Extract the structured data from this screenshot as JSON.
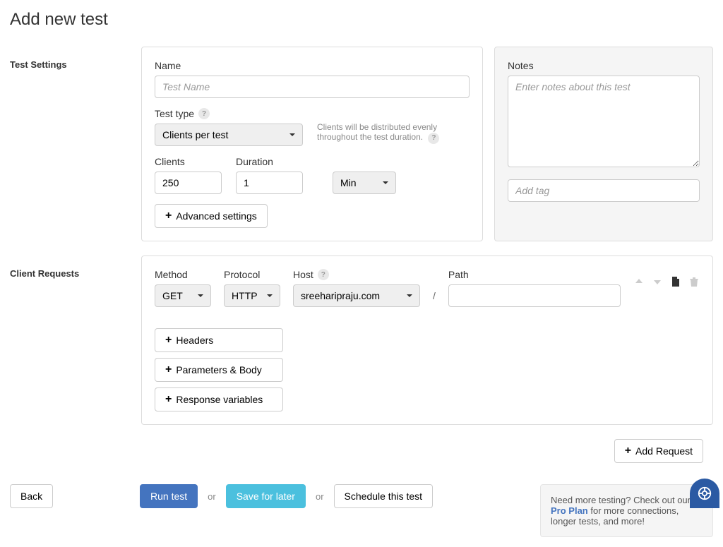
{
  "pageTitle": "Add new test",
  "sections": {
    "testSettings": "Test Settings",
    "clientRequests": "Client Requests"
  },
  "testSettings": {
    "nameLabel": "Name",
    "namePlaceholder": "Test Name",
    "nameValue": "",
    "testTypeLabel": "Test type",
    "testTypeValue": "Clients per test",
    "testTypeHelp": "Clients will be distributed evenly throughout the test duration.",
    "clientsLabel": "Clients",
    "clientsValue": "250",
    "durationLabel": "Duration",
    "durationValue": "1",
    "durationUnitValue": "Min",
    "advancedSettings": "Advanced settings"
  },
  "notes": {
    "notesLabel": "Notes",
    "notesPlaceholder": "Enter notes about this test",
    "notesValue": "",
    "addTagPlaceholder": "Add tag",
    "addTagValue": ""
  },
  "requests": {
    "methodLabel": "Method",
    "methodValue": "GET",
    "protocolLabel": "Protocol",
    "protocolValue": "HTTP",
    "hostLabel": "Host",
    "hostValue": "sreeharipraju.com",
    "pathLabel": "Path",
    "pathValue": "",
    "pathSeparator": "/",
    "headers": "Headers",
    "parametersBody": "Parameters & Body",
    "responseVariables": "Response variables",
    "addRequest": "Add Request"
  },
  "footer": {
    "back": "Back",
    "runTest": "Run test",
    "or": "or",
    "saveForLater": "Save for later",
    "scheduleThisTest": "Schedule this test",
    "proPlanPre": "Need more testing? Check out our ",
    "proPlanLink": "Pro Plan",
    "proPlanPost": " for more connections, longer tests, and more!"
  }
}
